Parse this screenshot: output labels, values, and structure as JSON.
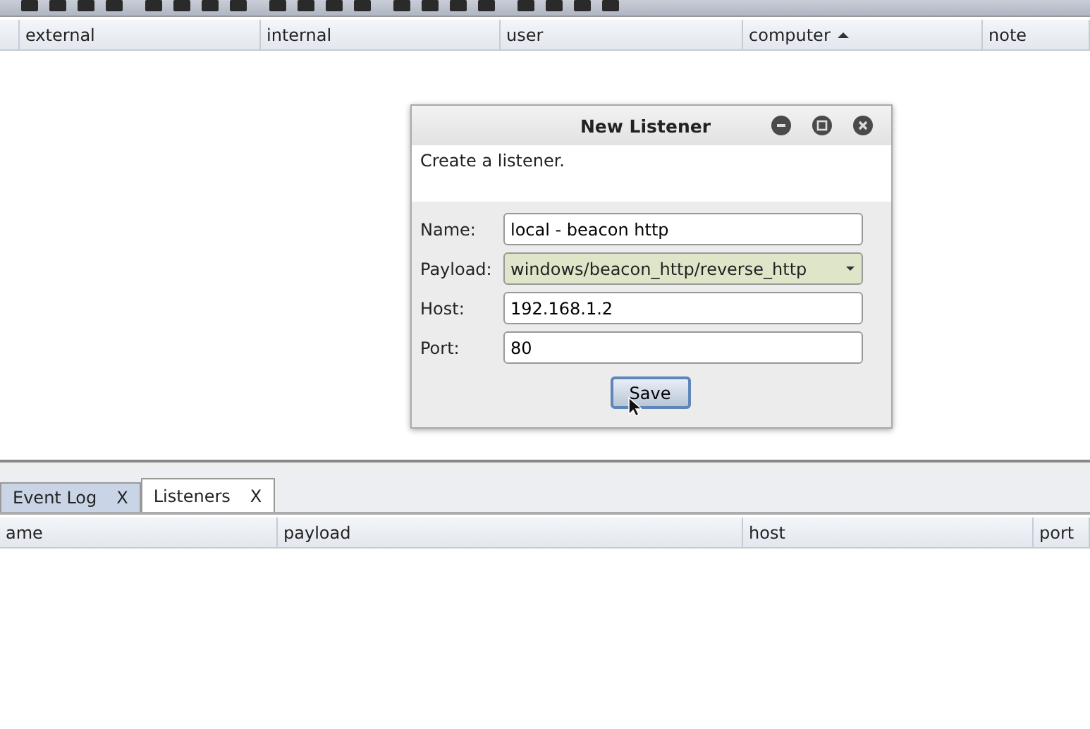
{
  "targets_table": {
    "columns": [
      {
        "sorted": false
      },
      {
        "label": "external",
        "sorted": false
      },
      {
        "label": "internal",
        "sorted": false
      },
      {
        "label": "user",
        "sorted": false
      },
      {
        "label": "computer",
        "sorted": true
      },
      {
        "label": "note",
        "sorted": false
      }
    ]
  },
  "dialog": {
    "title": "New Listener",
    "description": "Create a listener.",
    "fields": [
      {
        "kind": "text",
        "label": "Name:",
        "value": "local - beacon http"
      },
      {
        "kind": "dropdown",
        "label": "Payload:",
        "value": "windows/beacon_http/reverse_http"
      },
      {
        "kind": "text",
        "label": "Host:",
        "value": "192.168.1.2"
      },
      {
        "kind": "text",
        "label": "Port:",
        "value": "80"
      }
    ],
    "button": "Save"
  },
  "tabs": [
    {
      "label": "Event Log",
      "close": "X",
      "selected": false
    },
    {
      "label": "Listeners",
      "close": "X",
      "selected": true
    }
  ],
  "listeners_table": {
    "columns": [
      {
        "label": "ame"
      },
      {
        "label": "payload"
      },
      {
        "label": "host"
      },
      {
        "label": "port"
      }
    ]
  }
}
